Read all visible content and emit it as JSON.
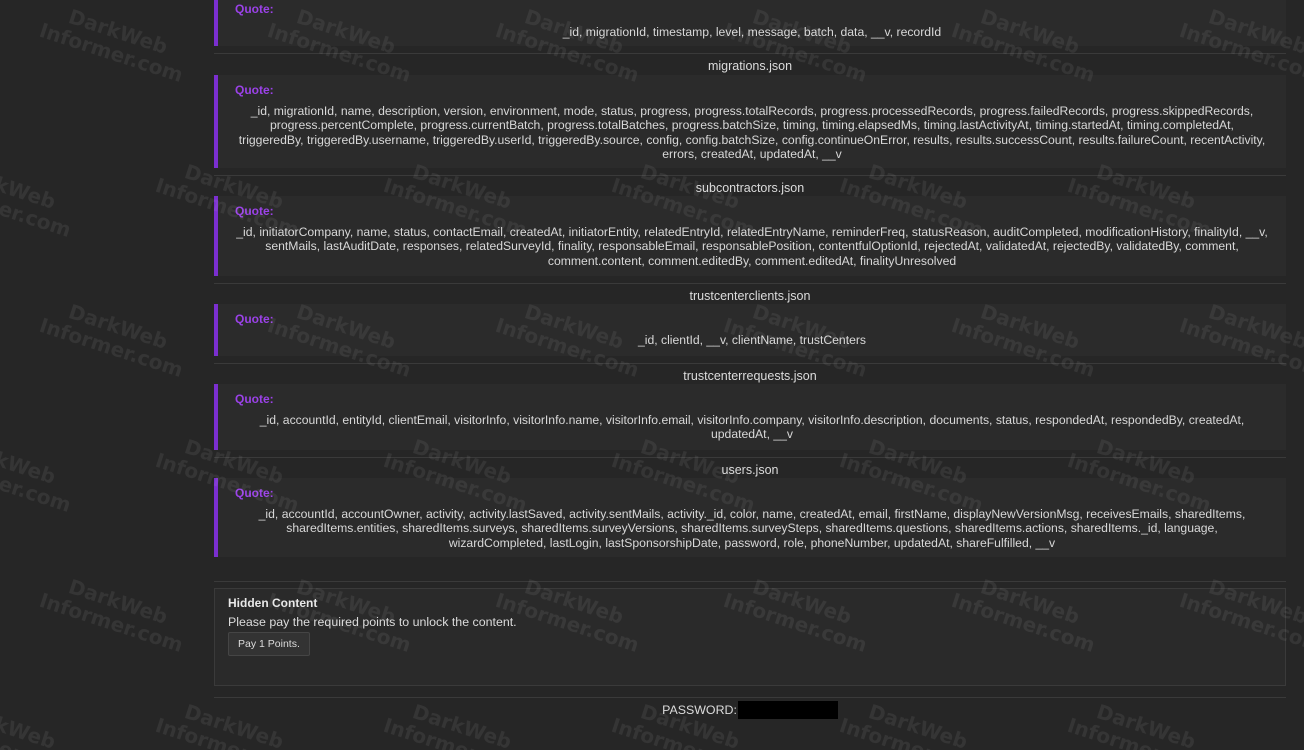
{
  "quote_label": "Quote:",
  "blocks": [
    {
      "filename": "",
      "text": "_id, migrationId, timestamp, level, message, batch, data, __v, recordId"
    },
    {
      "filename": "migrations.json",
      "text": "_id, migrationId, name, description, version, environment, mode, status, progress, progress.totalRecords, progress.processedRecords, progress.failedRecords, progress.skippedRecords, progress.percentComplete, progress.currentBatch, progress.totalBatches, progress.batchSize, timing, timing.elapsedMs, timing.lastActivityAt, timing.startedAt, timing.completedAt, triggeredBy, triggeredBy.username, triggeredBy.userId, triggeredBy.source, config, config.batchSize, config.continueOnError, results, results.successCount, results.failureCount, recentActivity, errors, createdAt, updatedAt, __v"
    },
    {
      "filename": "subcontractors.json",
      "text": "_id, initiatorCompany, name, status, contactEmail, createdAt, initiatorEntity, relatedEntryId, relatedEntryName, reminderFreq, statusReason, auditCompleted, modificationHistory, finalityId, __v, sentMails, lastAuditDate, responses, relatedSurveyId, finality, responsableEmail, responsablePosition, contentfulOptionId, rejectedAt, validatedAt, rejectedBy, validatedBy, comment, comment.content, comment.editedBy, comment.editedAt, finalityUnresolved"
    },
    {
      "filename": "trustcenterclients.json",
      "text": "_id, clientId, __v, clientName, trustCenters"
    },
    {
      "filename": "trustcenterrequests.json",
      "text": "_id, accountId, entityId, clientEmail, visitorInfo, visitorInfo.name, visitorInfo.email, visitorInfo.company, visitorInfo.description, documents, status, respondedAt, respondedBy, createdAt, updatedAt, __v"
    },
    {
      "filename": "users.json",
      "text": "_id, accountId, accountOwner, activity, activity.lastSaved, activity.sentMails, activity._id, color, name, createdAt, email, firstName, displayNewVersionMsg, receivesEmails, sharedItems, sharedItems.entities, sharedItems.surveys, sharedItems.surveyVersions, sharedItems.surveySteps, sharedItems.questions, sharedItems.actions, sharedItems._id, language, wizardCompleted, lastLogin, lastSponsorshipDate, password, role, phoneNumber, updatedAt, shareFulfilled, __v"
    }
  ],
  "hidden": {
    "title": "Hidden Content",
    "message": "Please pay the required points to unlock the content.",
    "button": "Pay 1 Points."
  },
  "password_label": "PASSWORD:",
  "watermark_line1": "DarkWeb",
  "watermark_line2": "Informer.com",
  "colors": {
    "background": "#262626",
    "quote_bg": "#2b2b2b",
    "accent": "#7b2fd0",
    "quote_label": "#9b42e8"
  }
}
